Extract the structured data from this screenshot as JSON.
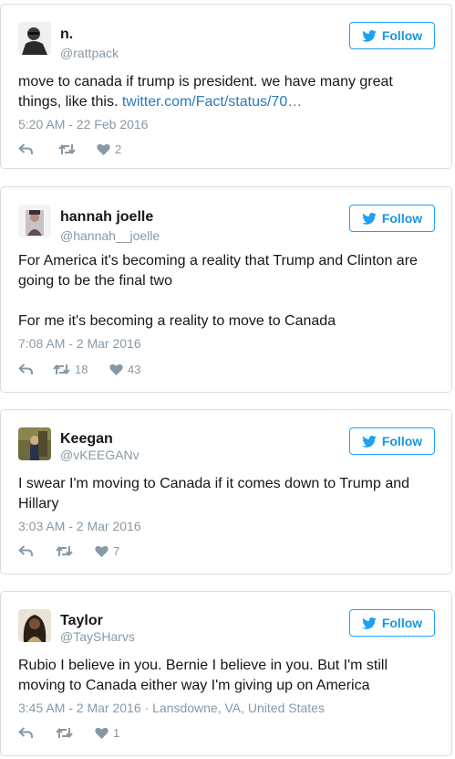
{
  "colors": {
    "accent": "#1da1f2",
    "link": "#2b7bb9",
    "secondary_text": "#8899a6",
    "border": "#d9dde0"
  },
  "follow_label": "Follow",
  "tweets": [
    {
      "name": "n.",
      "handle": "@rattpack",
      "text": "move to canada if trump is president. we have many great things, like this. ",
      "link": "twitter.com/Fact/status/70…",
      "timestamp": "5:20 AM - 22 Feb 2016",
      "retweets": "",
      "likes": "2"
    },
    {
      "name": "hannah joelle",
      "handle": "@hannah__joelle",
      "paragraphs": [
        "For America it's becoming a reality that Trump and Clinton are going to be the final two",
        "For me it's becoming a reality to move to Canada"
      ],
      "timestamp": "7:08 AM - 2 Mar 2016",
      "retweets": "18",
      "likes": "43"
    },
    {
      "name": "Keegan",
      "handle": "@vKEEGANv",
      "text": "I swear I'm moving to Canada if it comes down to Trump and Hillary",
      "timestamp": "3:03 AM - 2 Mar 2016",
      "retweets": "",
      "likes": "7"
    },
    {
      "name": "Taylor",
      "handle": "@TaySHarvs",
      "text": "Rubio I believe in you. Bernie I believe in you. But I'm still moving to Canada either way I'm giving up on America",
      "timestamp": "3:45 AM - 2 Mar 2016",
      "location": "Lansdowne, VA, United States",
      "retweets": "",
      "likes": "1"
    }
  ]
}
